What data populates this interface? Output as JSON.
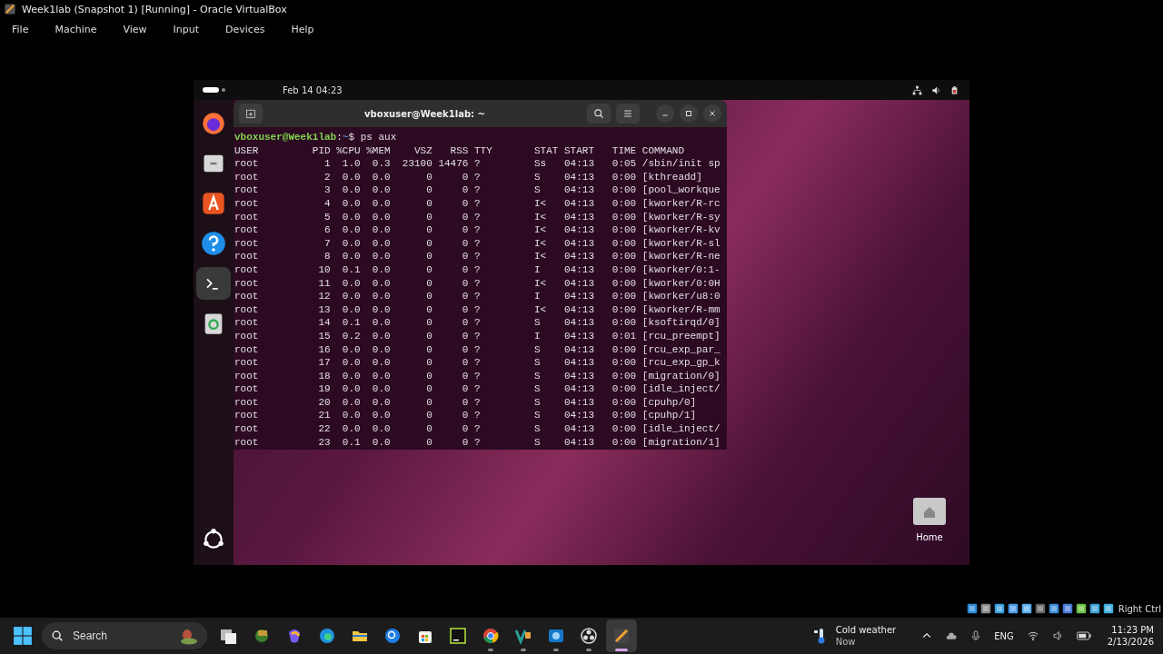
{
  "window": {
    "title": "Week1lab (Snapshot 1) [Running] - Oracle VirtualBox"
  },
  "menu": [
    "File",
    "Machine",
    "View",
    "Input",
    "Devices",
    "Help"
  ],
  "guest": {
    "topbar": {
      "clock": "Feb 14  04:23"
    },
    "dock": [
      {
        "selected": false
      },
      {
        "selected": false
      },
      {
        "selected": false
      },
      {
        "selected": false
      },
      {
        "selected": true
      },
      {
        "selected": false
      }
    ],
    "terminal": {
      "title": "vboxuser@Week1lab: ~",
      "prompt": {
        "user_host": "vboxuser@Week1lab",
        "separator": ":",
        "path": "~",
        "input": "$ ps aux"
      },
      "columns": [
        "USER",
        "PID",
        "%CPU",
        "%MEM",
        "VSZ",
        "RSS",
        "TTY",
        "STAT",
        "START",
        "TIME",
        "COMMAND"
      ],
      "rows": [
        [
          "root",
          "1",
          "1.0",
          "0.3",
          "23100",
          "14476",
          "?",
          "Ss",
          "04:13",
          "0:05",
          "/sbin/init sp"
        ],
        [
          "root",
          "2",
          "0.0",
          "0.0",
          "0",
          "0",
          "?",
          "S",
          "04:13",
          "0:00",
          "[kthreadd]"
        ],
        [
          "root",
          "3",
          "0.0",
          "0.0",
          "0",
          "0",
          "?",
          "S",
          "04:13",
          "0:00",
          "[pool_workque"
        ],
        [
          "root",
          "4",
          "0.0",
          "0.0",
          "0",
          "0",
          "?",
          "I<",
          "04:13",
          "0:00",
          "[kworker/R-rc"
        ],
        [
          "root",
          "5",
          "0.0",
          "0.0",
          "0",
          "0",
          "?",
          "I<",
          "04:13",
          "0:00",
          "[kworker/R-sy"
        ],
        [
          "root",
          "6",
          "0.0",
          "0.0",
          "0",
          "0",
          "?",
          "I<",
          "04:13",
          "0:00",
          "[kworker/R-kv"
        ],
        [
          "root",
          "7",
          "0.0",
          "0.0",
          "0",
          "0",
          "?",
          "I<",
          "04:13",
          "0:00",
          "[kworker/R-sl"
        ],
        [
          "root",
          "8",
          "0.0",
          "0.0",
          "0",
          "0",
          "?",
          "I<",
          "04:13",
          "0:00",
          "[kworker/R-ne"
        ],
        [
          "root",
          "10",
          "0.1",
          "0.0",
          "0",
          "0",
          "?",
          "I",
          "04:13",
          "0:00",
          "[kworker/0:1-"
        ],
        [
          "root",
          "11",
          "0.0",
          "0.0",
          "0",
          "0",
          "?",
          "I<",
          "04:13",
          "0:00",
          "[kworker/0:0H"
        ],
        [
          "root",
          "12",
          "0.0",
          "0.0",
          "0",
          "0",
          "?",
          "I",
          "04:13",
          "0:00",
          "[kworker/u8:0"
        ],
        [
          "root",
          "13",
          "0.0",
          "0.0",
          "0",
          "0",
          "?",
          "I<",
          "04:13",
          "0:00",
          "[kworker/R-mm"
        ],
        [
          "root",
          "14",
          "0.1",
          "0.0",
          "0",
          "0",
          "?",
          "S",
          "04:13",
          "0:00",
          "[ksoftirqd/0]"
        ],
        [
          "root",
          "15",
          "0.2",
          "0.0",
          "0",
          "0",
          "?",
          "I",
          "04:13",
          "0:01",
          "[rcu_preempt]"
        ],
        [
          "root",
          "16",
          "0.0",
          "0.0",
          "0",
          "0",
          "?",
          "S",
          "04:13",
          "0:00",
          "[rcu_exp_par_"
        ],
        [
          "root",
          "17",
          "0.0",
          "0.0",
          "0",
          "0",
          "?",
          "S",
          "04:13",
          "0:00",
          "[rcu_exp_gp_k"
        ],
        [
          "root",
          "18",
          "0.0",
          "0.0",
          "0",
          "0",
          "?",
          "S",
          "04:13",
          "0:00",
          "[migration/0]"
        ],
        [
          "root",
          "19",
          "0.0",
          "0.0",
          "0",
          "0",
          "?",
          "S",
          "04:13",
          "0:00",
          "[idle_inject/"
        ],
        [
          "root",
          "20",
          "0.0",
          "0.0",
          "0",
          "0",
          "?",
          "S",
          "04:13",
          "0:00",
          "[cpuhp/0]"
        ],
        [
          "root",
          "21",
          "0.0",
          "0.0",
          "0",
          "0",
          "?",
          "S",
          "04:13",
          "0:00",
          "[cpuhp/1]"
        ],
        [
          "root",
          "22",
          "0.0",
          "0.0",
          "0",
          "0",
          "?",
          "S",
          "04:13",
          "0:00",
          "[idle_inject/"
        ],
        [
          "root",
          "23",
          "0.1",
          "0.0",
          "0",
          "0",
          "?",
          "S",
          "04:13",
          "0:00",
          "[migration/1]"
        ]
      ]
    },
    "desktop_icons": [
      {
        "label": "Home"
      }
    ]
  },
  "host_key": "Right Ctrl",
  "taskbar": {
    "search": {
      "placeholder": "Search"
    },
    "apps": [
      {
        "running": false,
        "selected": false
      },
      {
        "running": false,
        "selected": false
      },
      {
        "running": false,
        "selected": false
      },
      {
        "running": false,
        "selected": false
      },
      {
        "running": false,
        "selected": false
      },
      {
        "running": false,
        "selected": false
      },
      {
        "running": false,
        "selected": false
      },
      {
        "running": false,
        "selected": false
      },
      {
        "running": true,
        "selected": false
      },
      {
        "running": true,
        "selected": false
      },
      {
        "running": true,
        "selected": false
      },
      {
        "running": true,
        "selected": false
      },
      {
        "running": true,
        "selected": true
      }
    ],
    "weather": {
      "title": "Cold weather",
      "subtitle": "Now"
    },
    "language": "ENG",
    "time": "11:23 PM",
    "date": "2/13/2026"
  }
}
